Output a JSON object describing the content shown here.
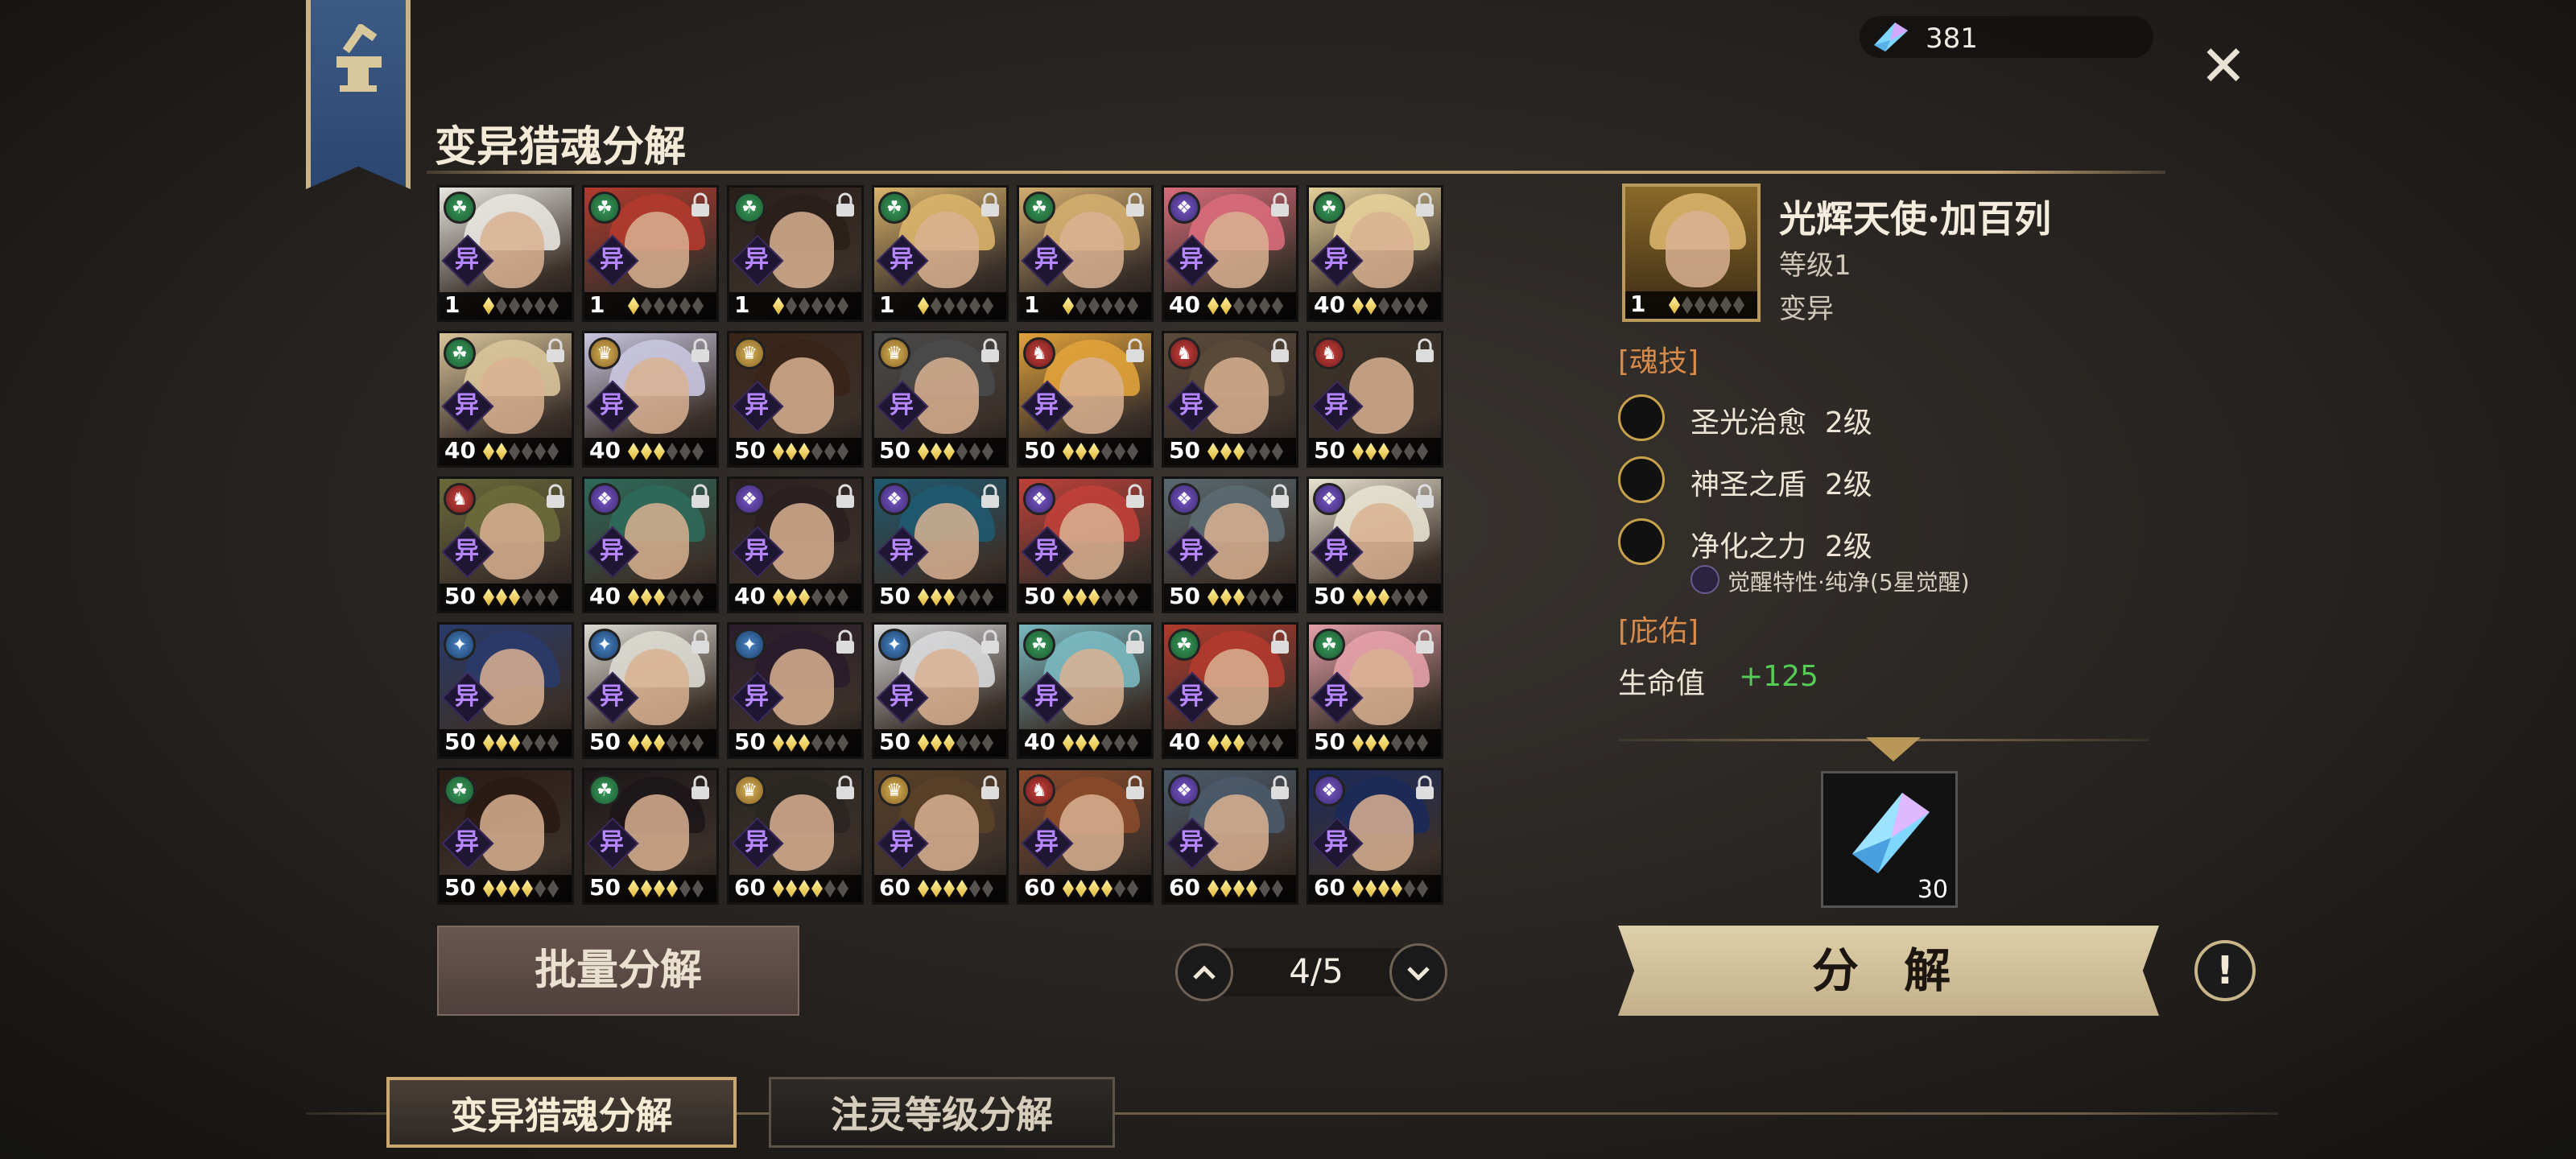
{
  "header": {
    "title": "变异猎魂分解",
    "currency_value": "381",
    "close_icon": "close-icon"
  },
  "grid": {
    "cards": [
      {
        "level": "1",
        "stars": 1,
        "faction": "green",
        "locked": false,
        "tag": "异",
        "hair": "#e8e6e0"
      },
      {
        "level": "1",
        "stars": 1,
        "faction": "green",
        "locked": true,
        "tag": "异",
        "hair": "#b23a2d"
      },
      {
        "level": "1",
        "stars": 1,
        "faction": "green",
        "locked": true,
        "tag": "异",
        "hair": "#2a1f1a"
      },
      {
        "level": "1",
        "stars": 1,
        "faction": "green",
        "locked": true,
        "tag": "异",
        "hair": "#d9b36a"
      },
      {
        "level": "1",
        "stars": 1,
        "faction": "green",
        "locked": true,
        "tag": "异",
        "hair": "#d3ad6f"
      },
      {
        "level": "40",
        "stars": 2,
        "faction": "purple",
        "locked": true,
        "tag": "异",
        "hair": "#d86c7a"
      },
      {
        "level": "40",
        "stars": 2,
        "faction": "green",
        "locked": true,
        "tag": "异",
        "hair": "#e5cf9a"
      },
      {
        "level": "40",
        "stars": 2,
        "faction": "green",
        "locked": true,
        "tag": "异",
        "hair": "#d9c49a"
      },
      {
        "level": "40",
        "stars": 3,
        "faction": "gold",
        "locked": true,
        "tag": "异",
        "hair": "#c9c6e0"
      },
      {
        "level": "50",
        "stars": 3,
        "faction": "gold",
        "locked": false,
        "tag": "异",
        "hair": "#3a2418"
      },
      {
        "level": "50",
        "stars": 3,
        "faction": "gold",
        "locked": true,
        "tag": "异",
        "hair": "#4a4a4a"
      },
      {
        "level": "50",
        "stars": 3,
        "faction": "red",
        "locked": true,
        "tag": "异",
        "hair": "#e1a23a"
      },
      {
        "level": "50",
        "stars": 3,
        "faction": "red",
        "locked": true,
        "tag": "异",
        "hair": "#5a4a3a"
      },
      {
        "level": "50",
        "stars": 3,
        "faction": "red",
        "locked": true,
        "tag": "异",
        "hair": "#3a3228"
      },
      {
        "level": "50",
        "stars": 3,
        "faction": "red",
        "locked": true,
        "tag": "异",
        "hair": "#6a6a3a"
      },
      {
        "level": "40",
        "stars": 3,
        "faction": "purple",
        "locked": true,
        "tag": "异",
        "hair": "#2e6a5a"
      },
      {
        "level": "40",
        "stars": 3,
        "faction": "purple",
        "locked": true,
        "tag": "异",
        "hair": "#2a2020"
      },
      {
        "level": "50",
        "stars": 3,
        "faction": "purple",
        "locked": true,
        "tag": "异",
        "hair": "#1f5a70"
      },
      {
        "level": "50",
        "stars": 3,
        "faction": "purple",
        "locked": true,
        "tag": "异",
        "hair": "#c0403a"
      },
      {
        "level": "50",
        "stars": 3,
        "faction": "purple",
        "locked": true,
        "tag": "异",
        "hair": "#5a6a70"
      },
      {
        "level": "50",
        "stars": 3,
        "faction": "purple",
        "locked": true,
        "tag": "异",
        "hair": "#e8e2d0"
      },
      {
        "level": "50",
        "stars": 3,
        "faction": "blue",
        "locked": false,
        "tag": "异",
        "hair": "#2a3a6a"
      },
      {
        "level": "50",
        "stars": 3,
        "faction": "blue",
        "locked": true,
        "tag": "异",
        "hair": "#dcdad2"
      },
      {
        "level": "50",
        "stars": 3,
        "faction": "blue",
        "locked": true,
        "tag": "异",
        "hair": "#2a1c2a"
      },
      {
        "level": "50",
        "stars": 3,
        "faction": "blue",
        "locked": true,
        "tag": "异",
        "hair": "#d8d8da"
      },
      {
        "level": "40",
        "stars": 3,
        "faction": "green",
        "locked": true,
        "tag": "异",
        "hair": "#7ab8c0"
      },
      {
        "level": "40",
        "stars": 3,
        "faction": "green",
        "locked": true,
        "tag": "异",
        "hair": "#b23a2d"
      },
      {
        "level": "50",
        "stars": 3,
        "faction": "green",
        "locked": true,
        "tag": "异",
        "hair": "#e4a0a8"
      },
      {
        "level": "50",
        "stars": 4,
        "faction": "green",
        "locked": false,
        "tag": "异",
        "hair": "#2a1a14"
      },
      {
        "level": "50",
        "stars": 4,
        "faction": "green",
        "locked": true,
        "tag": "异",
        "hair": "#1c1618"
      },
      {
        "level": "60",
        "stars": 4,
        "faction": "gold",
        "locked": true,
        "tag": "异",
        "hair": "#2a2622"
      },
      {
        "level": "60",
        "stars": 4,
        "faction": "gold",
        "locked": true,
        "tag": "异",
        "hair": "#5a4028"
      },
      {
        "level": "60",
        "stars": 4,
        "faction": "red",
        "locked": true,
        "tag": "异",
        "hair": "#8a4a2a"
      },
      {
        "level": "60",
        "stars": 4,
        "faction": "purple",
        "locked": true,
        "tag": "异",
        "hair": "#4a5a6a"
      },
      {
        "level": "60",
        "stars": 4,
        "faction": "purple",
        "locked": true,
        "tag": "异",
        "hair": "#1c2a5a"
      }
    ]
  },
  "actions": {
    "batch_label": "批量分解",
    "decompose_label": "分 解",
    "info_label": "!"
  },
  "pager": {
    "text": "4/5",
    "up": "^",
    "down": "v"
  },
  "detail": {
    "name": "光辉天使·加百列",
    "level": "等级1",
    "type": "变异",
    "selected_level": "1",
    "selected_stars": 1,
    "skills_header": "[魂技]",
    "skills": [
      {
        "name": "圣光治愈",
        "level": "2级"
      },
      {
        "name": "神圣之盾",
        "level": "2级"
      },
      {
        "name": "净化之力",
        "level": "2级"
      }
    ],
    "awaken_note": "觉醒特性·纯净(5星觉醒)",
    "bless_header": "[庇佑]",
    "stat_label": "生命值",
    "stat_value": "+125",
    "reward_count": "30"
  },
  "tabs": [
    {
      "label": "变异猎魂分解",
      "active": true
    },
    {
      "label": "注灵等级分解",
      "active": false
    }
  ],
  "colors": {
    "accent_gold": "#c8a877",
    "stat_green": "#55cc55",
    "section_orange": "#d88a4a",
    "tag_purple": "#b686ff"
  }
}
